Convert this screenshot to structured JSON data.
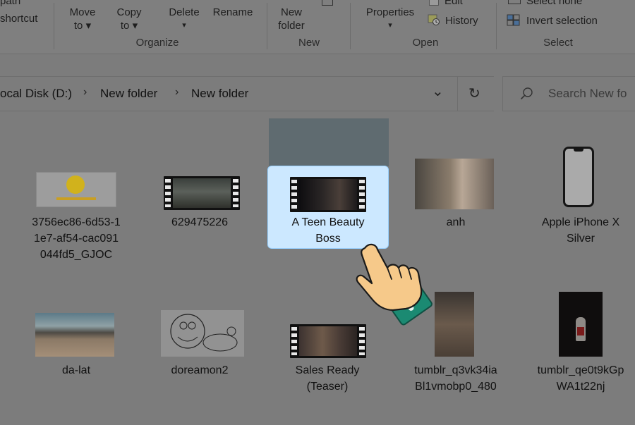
{
  "ribbon": {
    "path_label": "path",
    "shortcut_label": "shortcut",
    "move_to": [
      "Move",
      "to ▾"
    ],
    "copy_to": [
      "Copy",
      "to ▾"
    ],
    "delete_label": "Delete",
    "delete_caret": "▾",
    "rename_label": "Rename",
    "new_folder": [
      "New",
      "folder"
    ],
    "properties_label": "Properties",
    "properties_caret": "▾",
    "edit_label": "Edit",
    "history_label": "History",
    "select_none_label": "Select none",
    "invert_selection_label": "Invert selection",
    "groups": {
      "organize": "Organize",
      "new": "New",
      "open": "Open",
      "select": "Select"
    }
  },
  "address": {
    "crumbs": [
      "ocal Disk (D:)",
      "New folder",
      "New folder"
    ],
    "separator": "›",
    "dropdown_glyph": "⌄",
    "refresh_glyph": "↻"
  },
  "search": {
    "placeholder": "Search New fo"
  },
  "files": [
    {
      "name": [
        "3756ec86-6d53-1",
        "1e7-af54-cac091",
        "044fd5_GJOC"
      ],
      "kind": "image"
    },
    {
      "name": [
        "629475226"
      ],
      "kind": "video"
    },
    {
      "name": [
        "A Teen Beauty",
        "Boss"
      ],
      "kind": "video",
      "selected": true
    },
    {
      "name": [
        "anh"
      ],
      "kind": "image"
    },
    {
      "name": [
        "Apple iPhone X",
        "Silver"
      ],
      "kind": "image"
    },
    {
      "name": [
        "da-lat"
      ],
      "kind": "image"
    },
    {
      "name": [
        "doreamon2"
      ],
      "kind": "image"
    },
    {
      "name": [
        "Sales Ready",
        "(Teaser)"
      ],
      "kind": "video"
    },
    {
      "name": [
        "tumblr_q3vk34ia",
        "Bl1vmobp0_480"
      ],
      "kind": "image"
    },
    {
      "name": [
        "tumblr_qe0t9kGp",
        "WA1t22nj"
      ],
      "kind": "image"
    }
  ],
  "colors": {
    "overlay_gray": "#7c7c7c",
    "selection_fill": "#cce8ff",
    "selection_border": "#99d1ff",
    "hand_skin": "#f6c98a",
    "cuff_green": "#1b8a72"
  },
  "icons": [
    "pointing-hand-cursor-icon",
    "search-icon",
    "refresh-icon",
    "chevron-down-icon",
    "history-icon",
    "invert-selection-icon"
  ]
}
